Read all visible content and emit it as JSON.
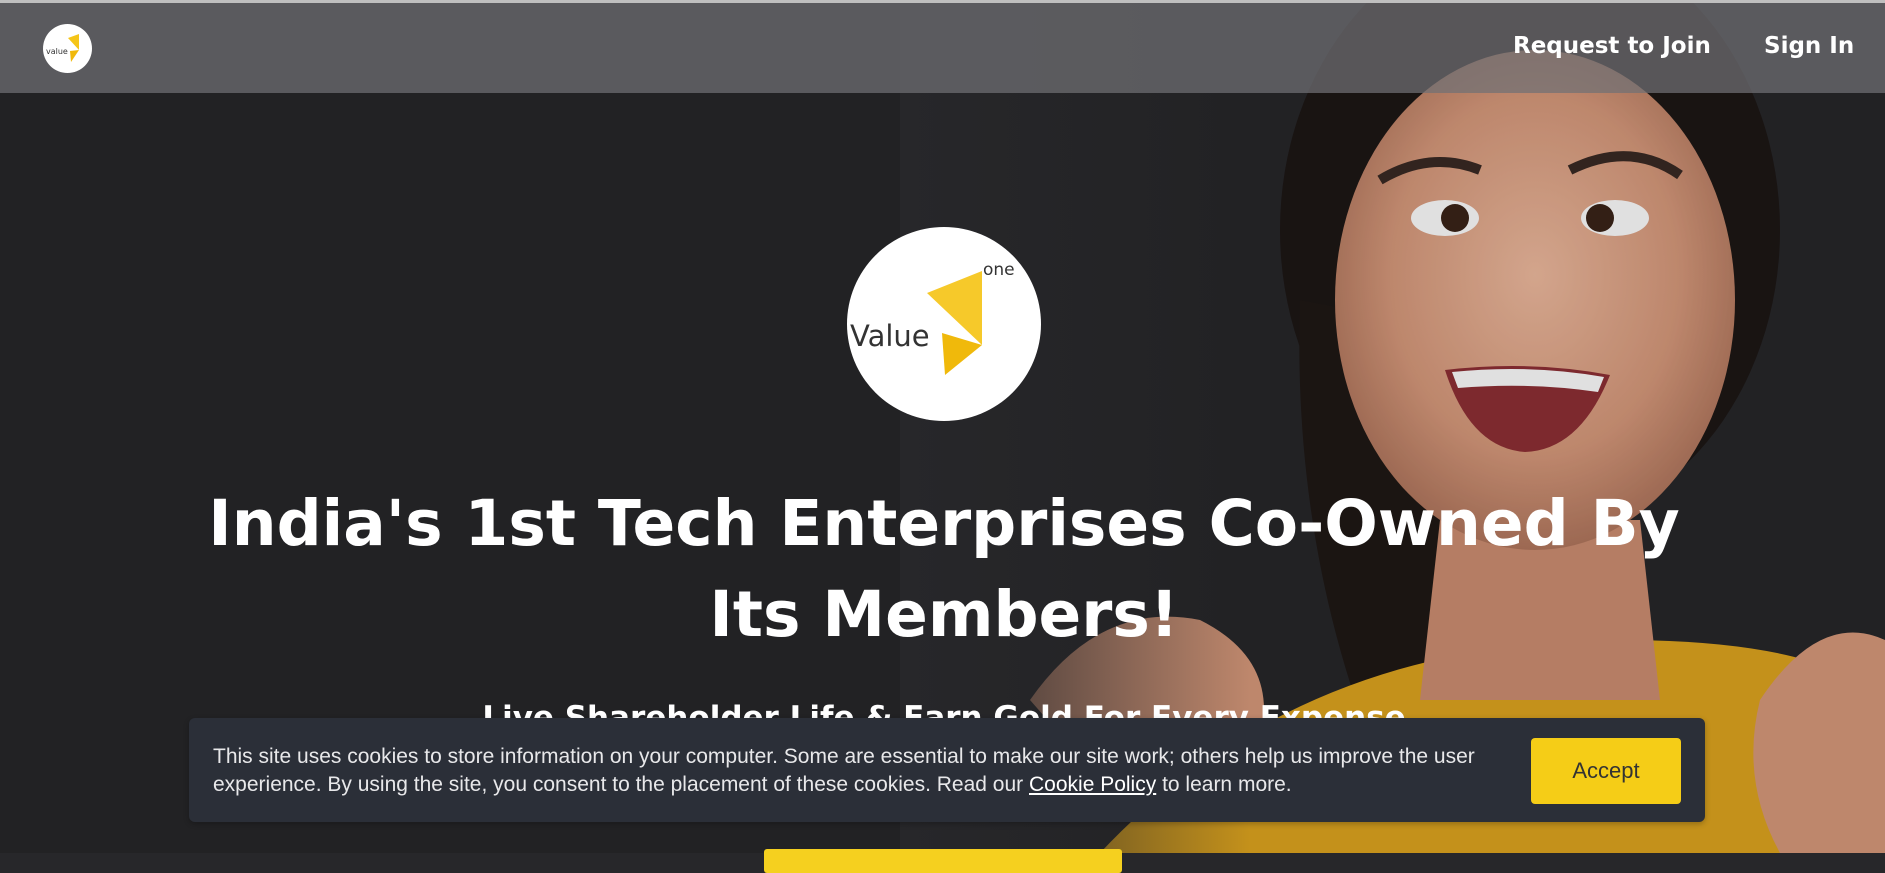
{
  "nav": {
    "logo_text": "value",
    "request_label": "Request to Join",
    "signin_label": "Sign In"
  },
  "hero": {
    "logo_main": "Value",
    "logo_sup": "one",
    "title_line1": "India's 1st Tech Enterprises Co-Owned By",
    "title_line2": "Its Members!",
    "subtitle": "Live Shareholder Life & Earn Gold For Every Expense"
  },
  "cookie": {
    "text_before": "This site uses cookies to store information on your computer. Some are essential to make our site work; others help us improve the user experience. By using the site, you consent to the placement of these cookies. Read our ",
    "link": "Cookie Policy",
    "text_after": " to learn more.",
    "accept_label": "Accept"
  },
  "colors": {
    "accent_yellow": "#f5cd17",
    "background": "#27272a",
    "banner": "#2b2f38"
  },
  "icons": {
    "brand": "value-one-logo"
  }
}
